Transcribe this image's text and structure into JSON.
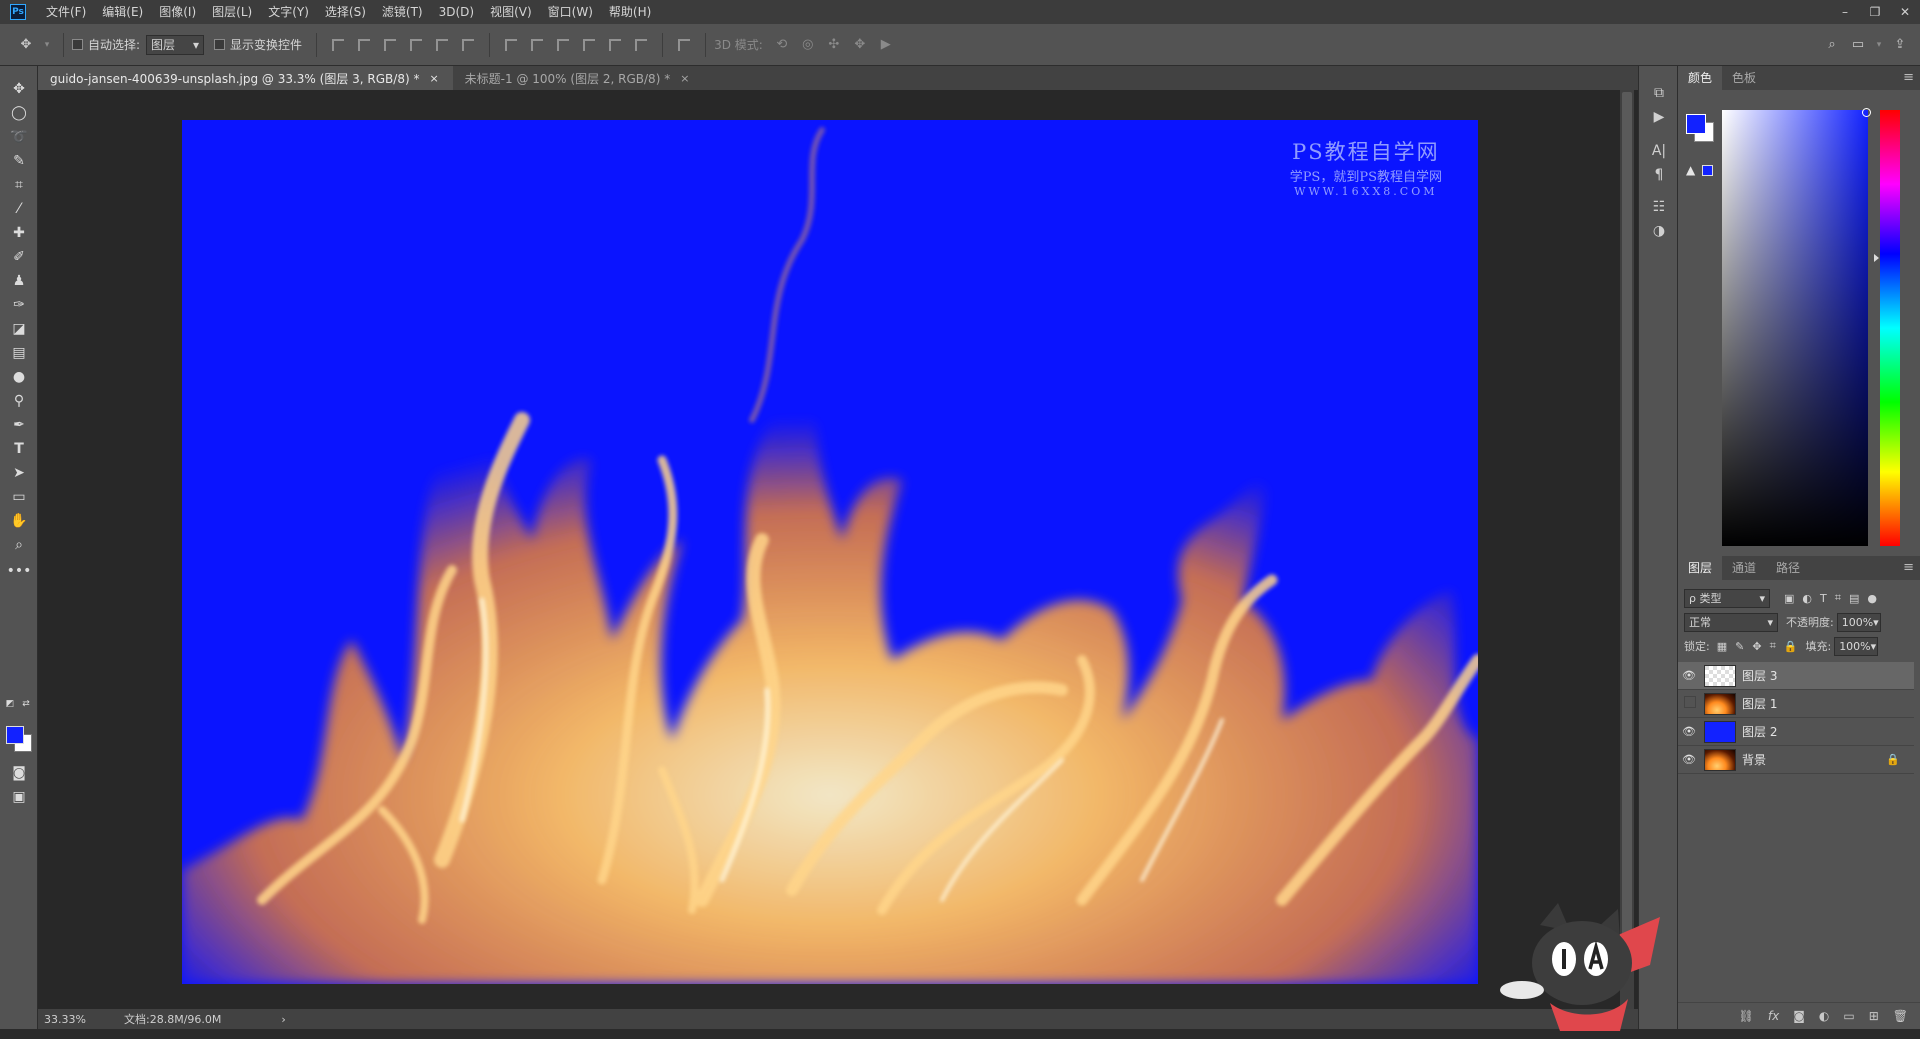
{
  "app": {
    "logo": "Ps"
  },
  "menu": [
    "文件(F)",
    "编辑(E)",
    "图像(I)",
    "图层(L)",
    "文字(Y)",
    "选择(S)",
    "滤镜(T)",
    "3D(D)",
    "视图(V)",
    "窗口(W)",
    "帮助(H)"
  ],
  "window_controls": {
    "minimize": "–",
    "restore": "❐",
    "close": "✕"
  },
  "options": {
    "auto_select_label": "自动选择:",
    "auto_select_value": "图层",
    "show_transform_label": "显示变换控件",
    "mode_3d_label": "3D 模式:"
  },
  "tabs": [
    {
      "label": "guido-jansen-400639-unsplash.jpg @ 33.3% (图层 3, RGB/8) *",
      "close": "×"
    },
    {
      "label": "未标题-1 @ 100% (图层 2, RGB/8) *",
      "close": "×"
    }
  ],
  "watermark": {
    "title": "PS教程自学网",
    "subtitle": "学PS，就到PS教程自学网",
    "url": "WWW.16XX8.COM"
  },
  "status": {
    "zoom": "33.33%",
    "doc": "文档:28.8M/96.0M",
    "arrow": "›"
  },
  "color_panel": {
    "tabs": [
      "颜色",
      "色板"
    ],
    "warning_icon": "▲",
    "menu_icon": "≡"
  },
  "layers_panel": {
    "tabs": [
      "图层",
      "通道",
      "路径"
    ],
    "menu_icon": "≡",
    "filter_label": "类型",
    "filter_prefix": "ρ",
    "blend_mode": "正常",
    "opacity_label": "不透明度:",
    "opacity_value": "100%",
    "lock_label": "锁定:",
    "fill_label": "填充:",
    "fill_value": "100%",
    "layers": [
      {
        "name": "图层 3",
        "visible": true,
        "thumb": "transparent",
        "selected": true
      },
      {
        "name": "图层 1",
        "visible": false,
        "thumb": "fire",
        "selected": false
      },
      {
        "name": "图层 2",
        "visible": true,
        "thumb": "blue",
        "selected": false
      },
      {
        "name": "背景",
        "visible": true,
        "thumb": "fire",
        "selected": false,
        "locked": true
      }
    ],
    "footer_icons": [
      "link-icon",
      "fx-icon",
      "mask-icon",
      "adjustment-icon",
      "folder-icon",
      "new-layer-icon",
      "trash-icon"
    ],
    "footer_glyphs": [
      "⛓",
      "fx",
      "◙",
      "◐",
      "▭",
      "⊞",
      "🗑"
    ]
  },
  "colors": {
    "foreground": "#1222ff",
    "background": "#ffffff",
    "canvas": "#0a14ff",
    "fire": "#ffb347"
  },
  "mascot": {
    "eyes": "I A"
  }
}
